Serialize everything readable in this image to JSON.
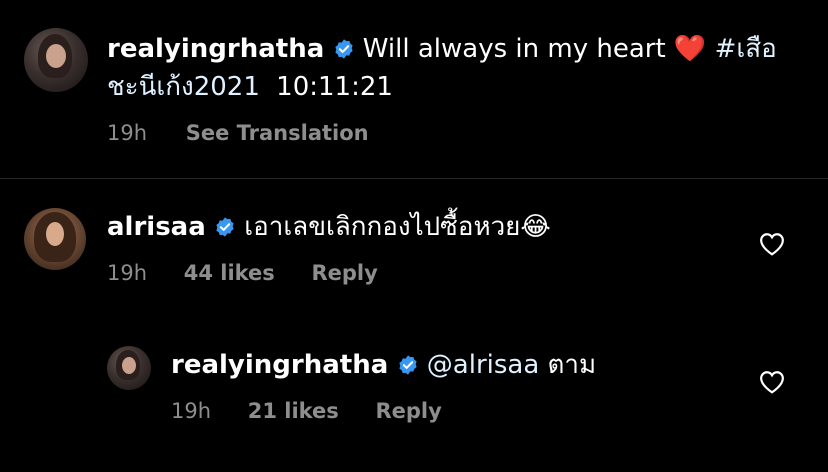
{
  "caption": {
    "username": "realyingrhatha",
    "text": "Will always in my heart",
    "emoji": "❤️",
    "hashtag": "#เสือชะนีเก้ง2021",
    "timestamp_inline": "10:11:21",
    "time": "19h",
    "see_translation": "See Translation"
  },
  "comments": [
    {
      "username": "alrisaa",
      "text": "เอาเลขเลิกกองไปซื้อหวย",
      "emoji": "😂",
      "time": "19h",
      "likes": "44 likes",
      "reply": "Reply"
    }
  ],
  "replies": [
    {
      "username": "realyingrhatha",
      "mention": "@alrisaa",
      "text": "ตาม",
      "time": "19h",
      "likes": "21 likes",
      "reply": "Reply"
    }
  ],
  "colors": {
    "background": "#000000",
    "text": "#ffffff",
    "secondary": "#8e8e8e",
    "verified": "#3897f0",
    "heart": "#ed4956"
  }
}
